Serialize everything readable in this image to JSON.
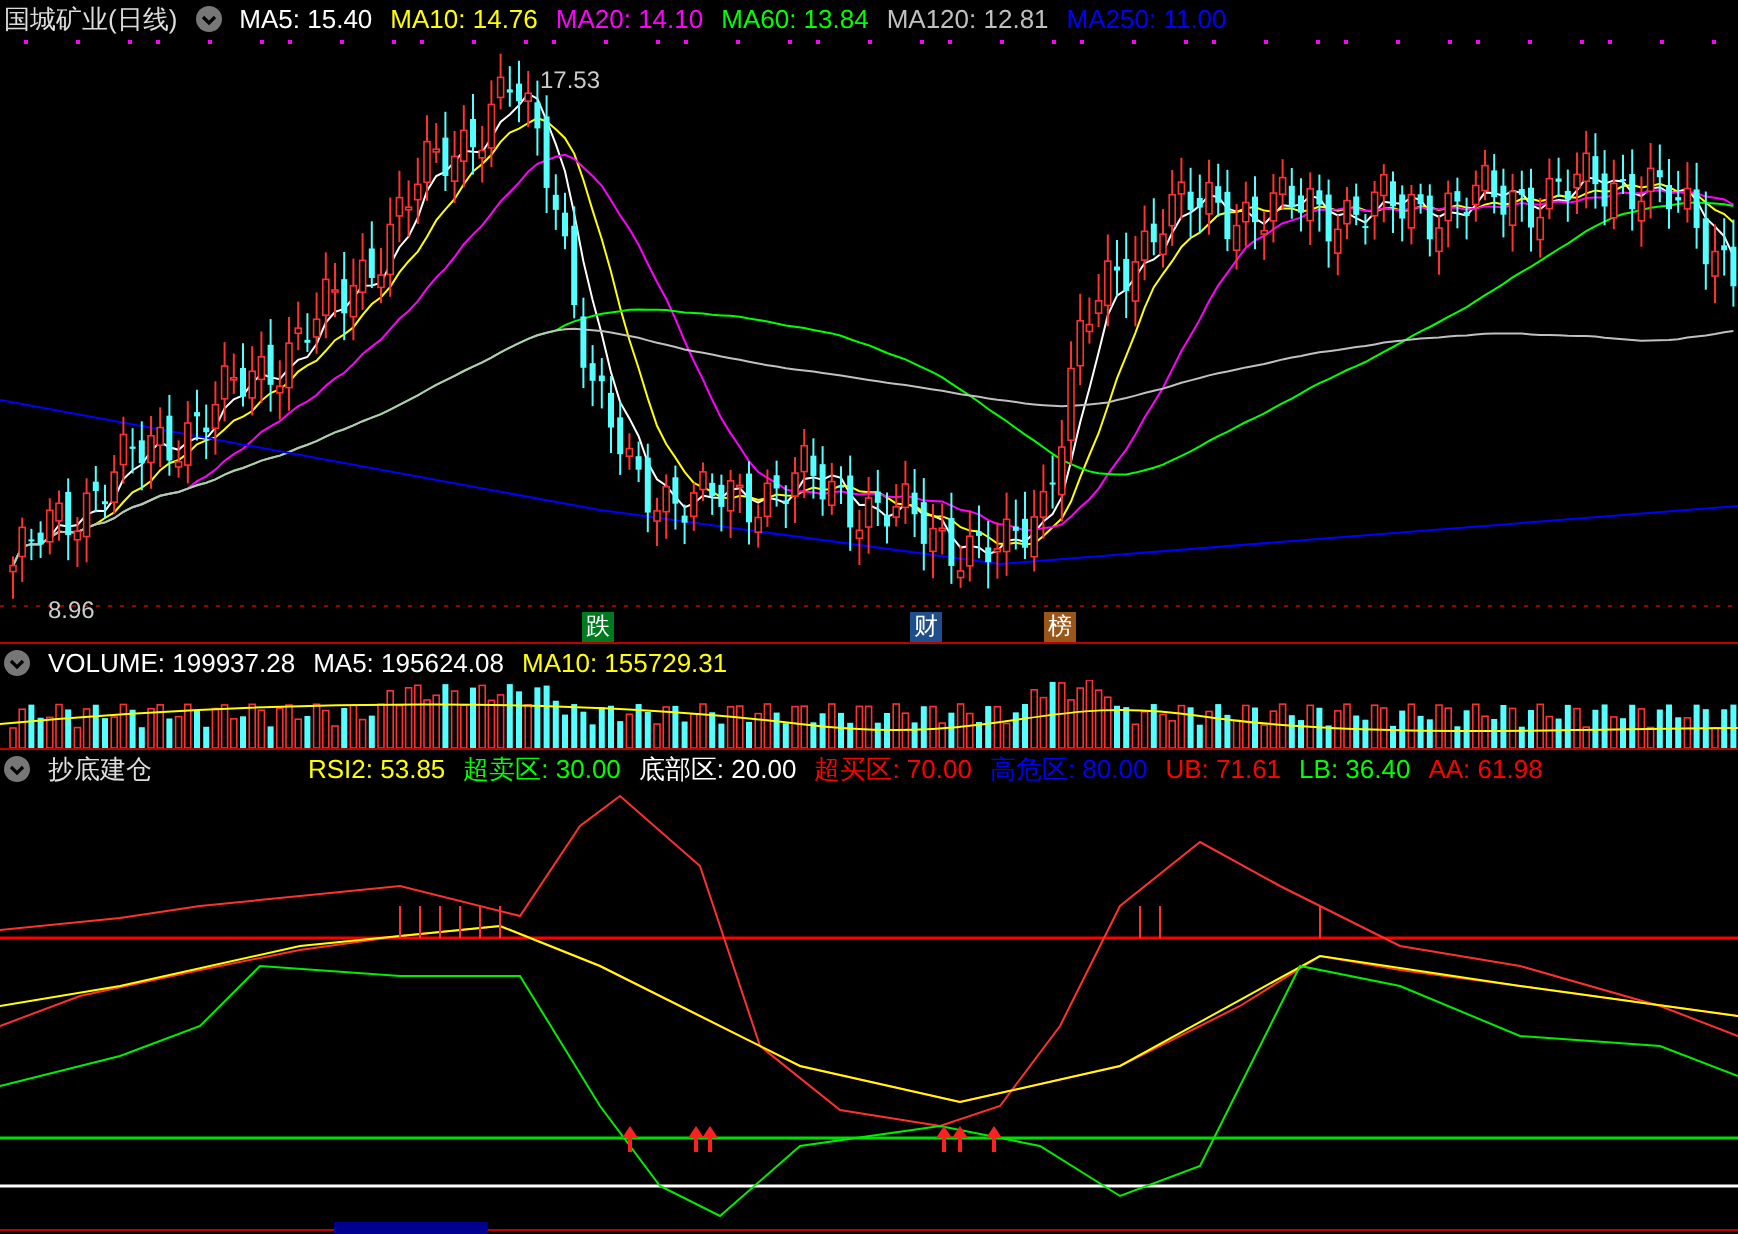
{
  "title": "国城矿业(日线)",
  "ma_legend": [
    {
      "label": "MA5: 15.40",
      "color": "#ffffff"
    },
    {
      "label": "MA10: 14.76",
      "color": "#ffff00"
    },
    {
      "label": "MA20: 14.10",
      "color": "#ff00ff"
    },
    {
      "label": "MA60: 13.84",
      "color": "#00ff00"
    },
    {
      "label": "MA120: 12.81",
      "color": "#c0c0c0"
    },
    {
      "label": "MA250: 11.00",
      "color": "#0000ff"
    }
  ],
  "price_labels": {
    "high": "17.53",
    "low": "8.96"
  },
  "event_tags": [
    {
      "label": "跌",
      "color": "#007a1e"
    },
    {
      "label": "财",
      "color": "#1f4e8c"
    },
    {
      "label": "榜",
      "color": "#9a5518"
    }
  ],
  "volume_panel": {
    "legend": [
      {
        "label": "VOLUME: 199937.28",
        "color": "#ffffff"
      },
      {
        "label": "MA5: 195624.08",
        "color": "#ffffff"
      },
      {
        "label": "MA10: 155729.31",
        "color": "#ffff00"
      }
    ]
  },
  "indicator_panel": {
    "title": "抄底建仓",
    "legend": [
      {
        "label": "RSI2: 53.85",
        "color": "#ffff00"
      },
      {
        "label": "超卖区: 30.00",
        "color": "#00ff00"
      },
      {
        "label": "底部区: 20.00",
        "color": "#ffffff"
      },
      {
        "label": "超买区: 70.00",
        "color": "#ff0000"
      },
      {
        "label": "高危区: 80.00",
        "color": "#0000ff"
      },
      {
        "label": "UB: 71.61",
        "color": "#ff0000"
      },
      {
        "label": "LB: 36.40",
        "color": "#00ff00"
      },
      {
        "label": "AA: 61.98",
        "color": "#ff0000"
      }
    ]
  }
}
